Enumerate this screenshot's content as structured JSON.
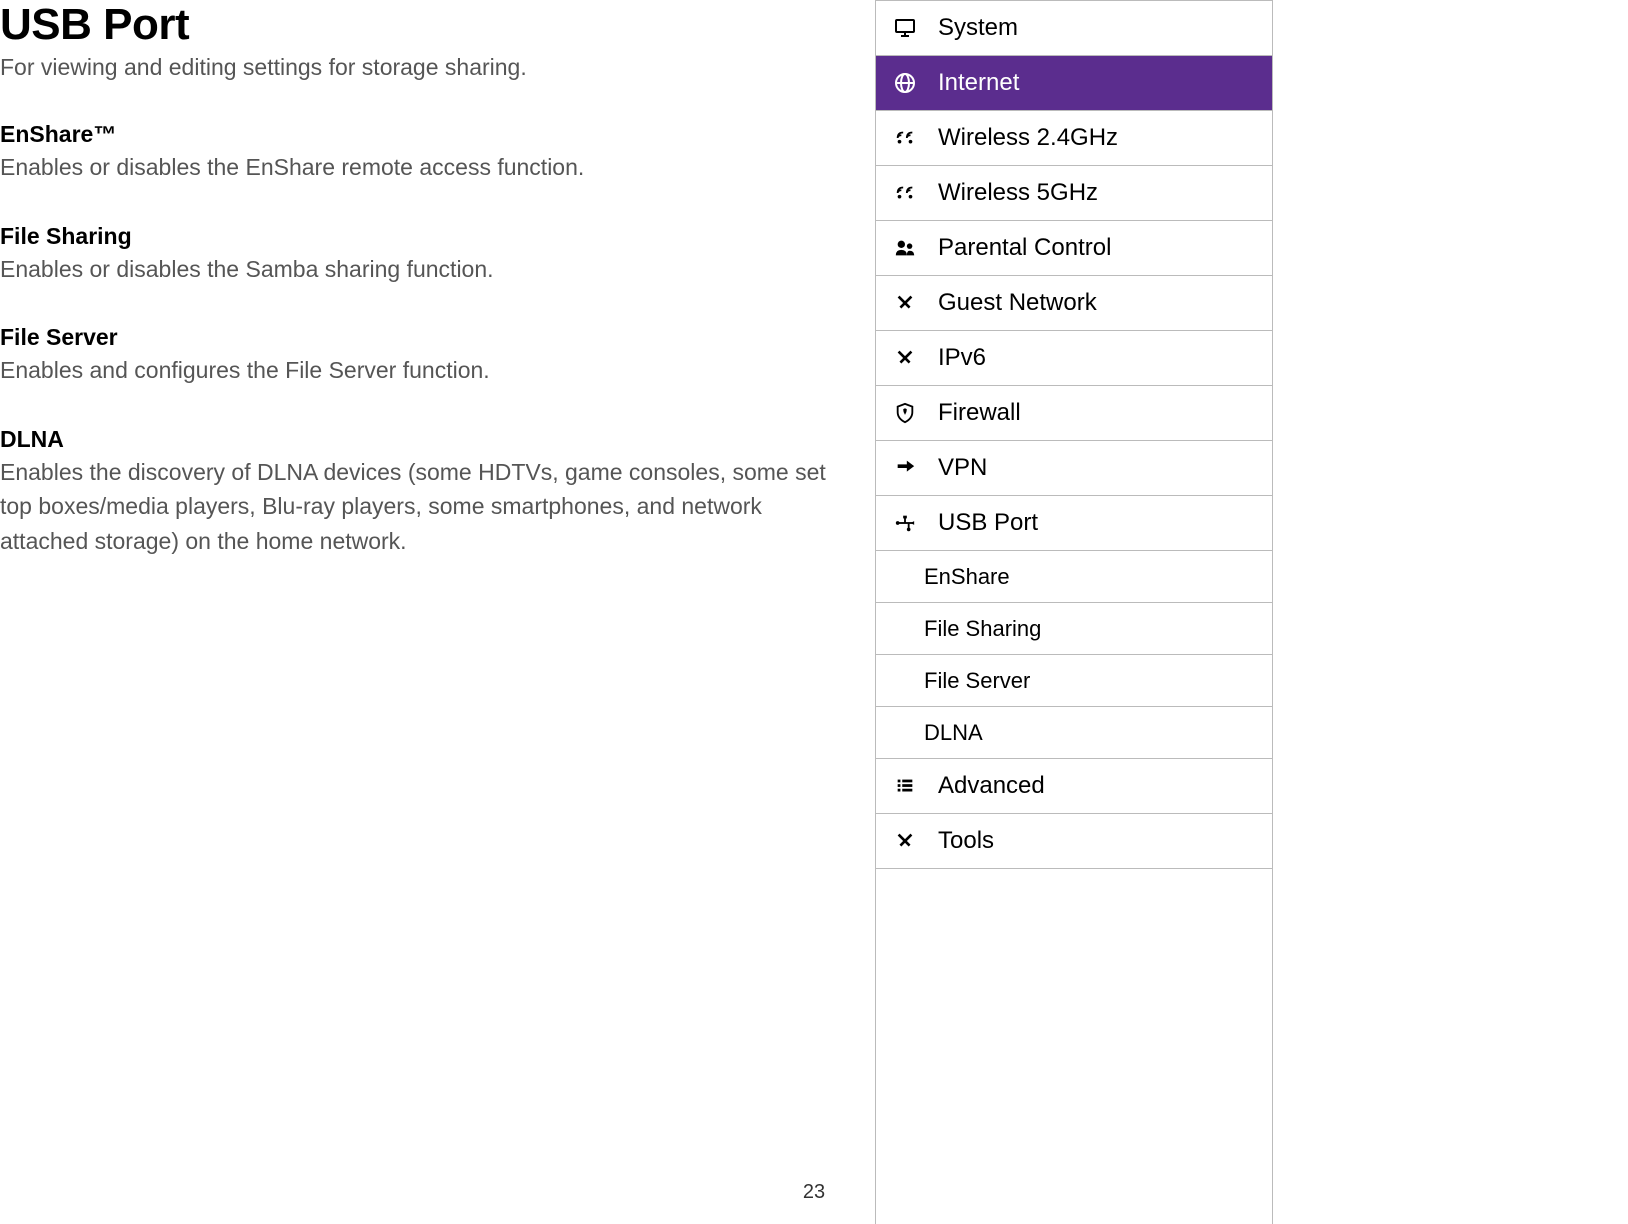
{
  "page": {
    "title": "USB Port",
    "subtitle": "For viewing and editing settings for storage sharing.",
    "number": "23"
  },
  "sections": [
    {
      "heading": "EnShare™",
      "desc": "Enables or disables the EnShare remote access function."
    },
    {
      "heading": "File Sharing",
      "desc": "Enables or disables the Samba sharing function."
    },
    {
      "heading": "File Server",
      "desc": "Enables and configures the File Server function."
    },
    {
      "heading": "DLNA",
      "desc": "Enables the discovery of DLNA devices (some HDTVs, game consoles, some set top boxes/media players, Blu-ray players, some smartphones, and network attached storage) on the home network."
    }
  ],
  "menu": {
    "items": [
      {
        "label": "System",
        "icon": "monitor"
      },
      {
        "label": "Internet",
        "icon": "globe",
        "active": true
      },
      {
        "label": "Wireless 2.4GHz",
        "icon": "wifi"
      },
      {
        "label": "Wireless 5GHz",
        "icon": "wifi"
      },
      {
        "label": "Parental Control",
        "icon": "users"
      },
      {
        "label": "Guest Network",
        "icon": "tools"
      },
      {
        "label": "IPv6",
        "icon": "tools"
      },
      {
        "label": "Firewall",
        "icon": "shield"
      },
      {
        "label": "VPN",
        "icon": "arrow"
      },
      {
        "label": "USB Port",
        "icon": "usb"
      }
    ],
    "sub": [
      {
        "label": "EnShare"
      },
      {
        "label": "File Sharing"
      },
      {
        "label": "File Server"
      },
      {
        "label": "DLNA"
      }
    ],
    "tail": [
      {
        "label": "Advanced",
        "icon": "list"
      },
      {
        "label": "Tools",
        "icon": "tools"
      }
    ]
  }
}
